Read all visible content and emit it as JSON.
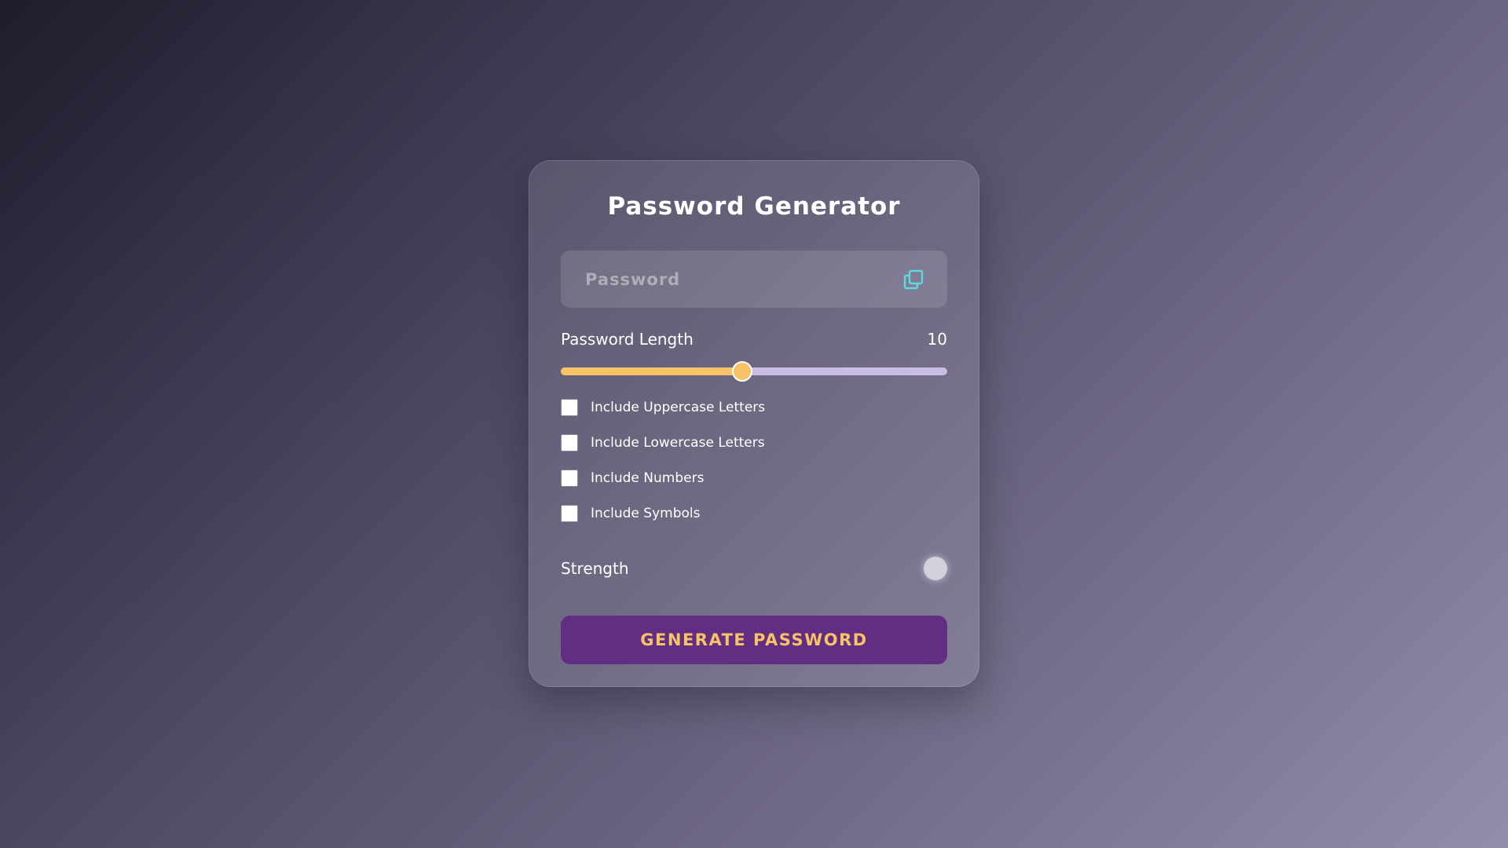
{
  "app": {
    "title": "Password Generator"
  },
  "password_field": {
    "placeholder": "Password",
    "value": "",
    "copy_icon": "copy-icon"
  },
  "length": {
    "label": "Password Length",
    "value": "10",
    "slider_fraction": 0.47
  },
  "options": [
    {
      "label": "Include Uppercase Letters",
      "checked": false
    },
    {
      "label": "Include Lowercase Letters",
      "checked": false
    },
    {
      "label": "Include Numbers",
      "checked": false
    },
    {
      "label": "Include Symbols",
      "checked": false
    }
  ],
  "strength": {
    "label": "Strength",
    "indicator_color": "#d3d0da"
  },
  "generate_button": {
    "label": "GENERATE PASSWORD"
  },
  "colors": {
    "accent_yellow": "#f8c266",
    "track_lavender": "#c9bde6",
    "button_purple": "#612e84",
    "copy_icon_cyan": "#5fd8e0"
  }
}
